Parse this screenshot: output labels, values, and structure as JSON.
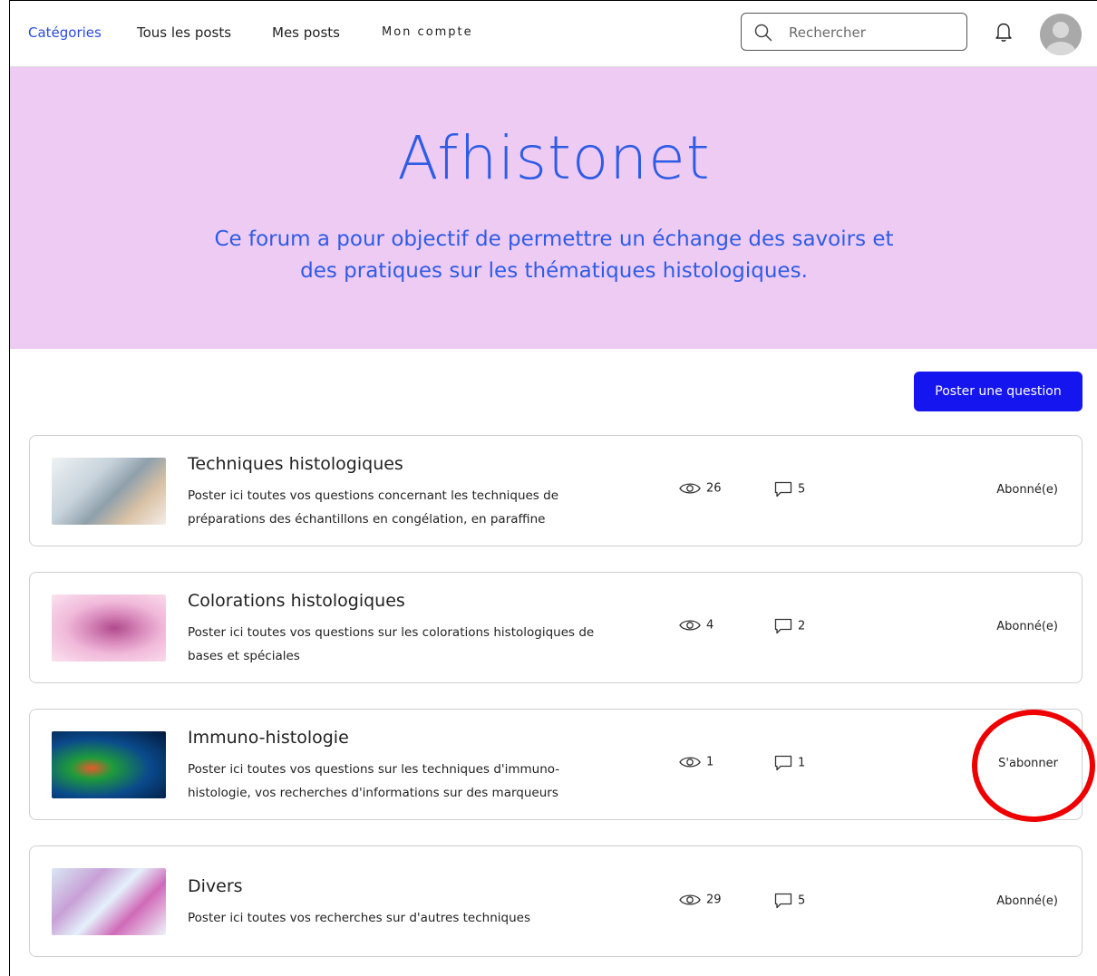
{
  "nav": {
    "links": [
      "Catégories",
      "Tous les posts",
      "Mes posts",
      "Mon compte"
    ],
    "search_placeholder": "Rechercher"
  },
  "hero": {
    "title": "Afhistonet",
    "subtitle_line1": "Ce forum a pour objectif de permettre un échange des savoirs et",
    "subtitle_line2": "des pratiques sur les thématiques histologiques."
  },
  "actions": {
    "post_question": "Poster une question"
  },
  "categories": [
    {
      "title": "Techniques histologiques",
      "desc_line1": "Poster ici toutes vos questions concernant les techniques de",
      "desc_line2": "préparations des échantillons en congélation, en paraffine",
      "views": "26",
      "comments": "5",
      "follow": "Abonné(e)"
    },
    {
      "title": "Colorations histologiques",
      "desc_line1": "Poster ici toutes vos questions sur les colorations histologiques de",
      "desc_line2": "bases et spéciales",
      "views": "4",
      "comments": "2",
      "follow": "Abonné(e)"
    },
    {
      "title": "Immuno-histologie",
      "desc_line1": "Poster ici toutes vos questions sur les techniques d'immuno-",
      "desc_line2": "histologie, vos recherches d'informations sur des marqueurs",
      "views": "1",
      "comments": "1",
      "follow": "S'abonner"
    },
    {
      "title": "Divers",
      "desc_line1": "Poster ici toutes vos recherches sur d'autres techniques",
      "desc_line2": "",
      "views": "29",
      "comments": "5",
      "follow": "Abonné(e)"
    }
  ],
  "colors": {
    "accent": "#2e5ce6",
    "hero_bg": "#eecbf3",
    "button_bg": "#1515ef",
    "annotation": "#ee0000"
  },
  "icons": [
    "search-icon",
    "bell-icon",
    "avatar",
    "eye-icon",
    "comment-icon"
  ]
}
